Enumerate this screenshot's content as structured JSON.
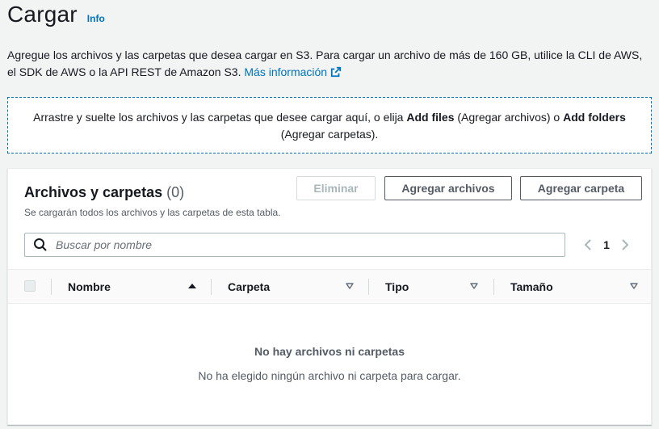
{
  "page": {
    "title": "Cargar",
    "info_label": "Info",
    "description": "Agregue los archivos y las carpetas que desea cargar en S3. Para cargar un archivo de más de 160 GB, utilice la CLI de AWS, el SDK de AWS o la API REST de Amazon S3.",
    "learn_more": "Más información"
  },
  "dropzone": {
    "text_1": "Arrastre y suelte los archivos y las carpetas que desee cargar aquí, o elija ",
    "add_files": "Add files",
    "text_2": " (Agregar archivos) o ",
    "add_folders": "Add folders",
    "text_3": " (Agregar carpetas)."
  },
  "panel": {
    "title": "Archivos y carpetas",
    "count": "(0)",
    "subtitle": "Se cargarán todos los archivos y las carpetas de esta tabla.",
    "buttons": {
      "delete": "Eliminar",
      "add_files": "Agregar archivos",
      "add_folder": "Agregar carpeta"
    },
    "search": {
      "placeholder": "Buscar por nombre",
      "value": ""
    },
    "pagination": {
      "current_page": "1"
    },
    "columns": [
      {
        "label": "Nombre",
        "sort": "ascending"
      },
      {
        "label": "Carpeta",
        "sort": "none"
      },
      {
        "label": "Tipo",
        "sort": "none"
      },
      {
        "label": "Tamaño",
        "sort": "none"
      }
    ],
    "empty_state": {
      "title": "No hay archivos ni carpetas",
      "description": "No ha elegido ningún archivo ni carpeta para cargar."
    }
  },
  "icons": {
    "external_link": "external-link-icon",
    "search": "search-icon",
    "prev": "chevron-left-icon",
    "next": "chevron-right-icon",
    "sort_asc": "caret-up-filled-icon",
    "sort_none": "caret-down-outline-icon"
  },
  "colors": {
    "link": "#0073bb",
    "text": "#16191f",
    "secondary_text": "#545b64",
    "background": "#f2f3f3"
  }
}
